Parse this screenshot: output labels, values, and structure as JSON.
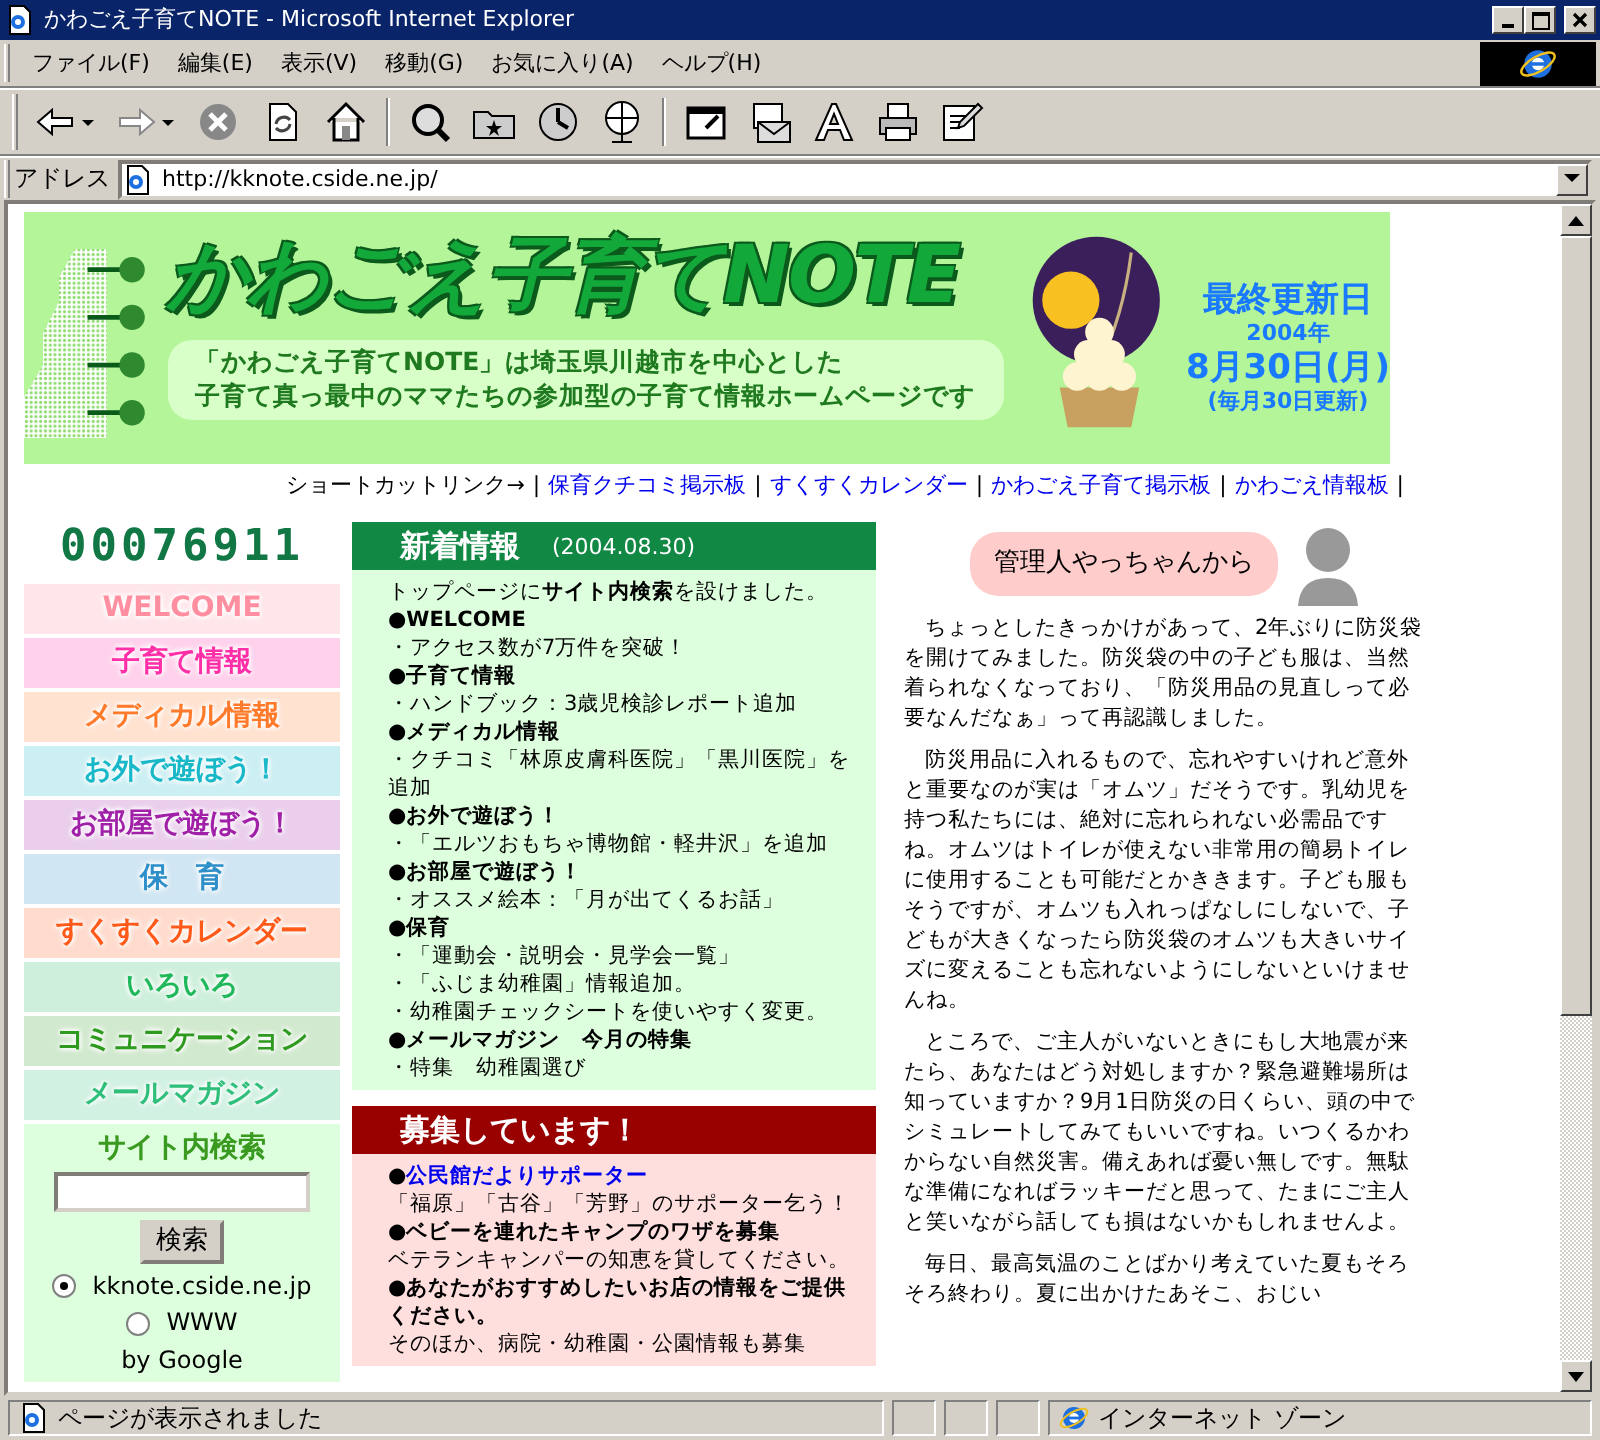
{
  "window": {
    "title": "かわごえ子育てNOTE - Microsoft Internet Explorer"
  },
  "menu": [
    "ファイル(F)",
    "編集(E)",
    "表示(V)",
    "移動(G)",
    "お気に入り(A)",
    "ヘルプ(H)"
  ],
  "address_bar": {
    "label": "アドレス",
    "value": "http://kknote.cside.ne.jp/"
  },
  "banner": {
    "title": "かわごえ子育てNOTE",
    "tagline": [
      "「かわごえ子育てNOTE」は埼玉県川越市を中心とした",
      "子育て真っ最中のママたちの参加型の子育て情報ホームページです"
    ],
    "updated_label": "最終更新日",
    "updated_year": "2004年",
    "updated_date": "8月30日(月)",
    "update_note": "(毎月30日更新)"
  },
  "shortcuts": {
    "label": "ショートカットリンク→",
    "separator": "|",
    "links": [
      "保育クチコミ掲示板",
      "すくすくカレンダー",
      "かわごえ子育て掲示板",
      "かわごえ情報板"
    ]
  },
  "counter": "00076911",
  "sidebar": {
    "items": [
      {
        "label": "WELCOME",
        "color": "#ff8fa0"
      },
      {
        "label": "子育て情報",
        "color": "#ff2fa8"
      },
      {
        "label": "メディカル情報",
        "color": "#ff7a2a"
      },
      {
        "label": "お外で遊ぼう！",
        "color": "#19b8c8"
      },
      {
        "label": "お部屋で遊ぼう！",
        "color": "#a020a8"
      },
      {
        "label": "保　育",
        "color": "#2f8fc8"
      },
      {
        "label": "すくすくカレンダー",
        "color": "#ff5a1a"
      },
      {
        "label": "いろいろ",
        "color": "#1fb85a"
      },
      {
        "label": "コミュニケーション",
        "color": "#2f9a20"
      },
      {
        "label": "メールマガジン",
        "color": "#2fbf7a"
      }
    ]
  },
  "site_search": {
    "title": "サイト内検索",
    "button": "検索",
    "options": [
      {
        "label": "kknote.cside.ne.jp",
        "selected": true
      },
      {
        "label": "WWW",
        "selected": false
      }
    ],
    "credit": "by Google"
  },
  "news": {
    "title": "新着情報",
    "date": "(2004.08.30)",
    "items": [
      {
        "text": "トップページに**サイト内検索**を設けました。"
      },
      {
        "text": "**●WELCOME**"
      },
      {
        "text": "・アクセス数が7万件を突破！"
      },
      {
        "text": "**●子育て情報**"
      },
      {
        "text": "・ハンドブック：3歳児検診レポート追加"
      },
      {
        "text": "**●メディカル情報**"
      },
      {
        "text": "・クチコミ「林原皮膚科医院」「黒川医院」を追加"
      },
      {
        "text": "**●お外で遊ぼう！**"
      },
      {
        "text": "・「エルツおもちゃ博物館・軽井沢」を追加"
      },
      {
        "text": "**●お部屋で遊ぼう！**"
      },
      {
        "text": "・オススメ絵本：「月が出てくるお話」"
      },
      {
        "text": "**●保育**"
      },
      {
        "text": "・「運動会・説明会・見学会一覧」"
      },
      {
        "text": "・「ふじま幼稚園」情報追加。"
      },
      {
        "text": "・幼稚園チェックシートを使いやすく変更。"
      },
      {
        "text": "**●メールマガジン　今月の特集**"
      },
      {
        "text": "・特集　幼稚園選び"
      }
    ]
  },
  "recruit": {
    "title": "募集しています！",
    "items": [
      {
        "marker": "**●**",
        "link": "**公民館だよりサポーター**"
      },
      {
        "text": "「福原」「古谷」「芳野」のサポーター乞う！"
      },
      {
        "text": "**●ベビーを連れたキャンプのワザを募集**"
      },
      {
        "text": "ベテランキャンパーの知恵を貸してください。"
      },
      {
        "text": "**●あなたがおすすめしたいお店の情報をご提供ください。**"
      },
      {
        "text": "そのほか、病院・幼稚園・公園情報も募集"
      }
    ]
  },
  "admin": {
    "bubble": "管理人やっちゃんから",
    "paragraphs": [
      "ちょっとしたきっかけがあって、2年ぶりに防災袋を開けてみました。防災袋の中の子ども服は、当然着られなくなっており、「防災用品の見直しって必要なんだなぁ」って再認識しました。",
      "防災用品に入れるもので、忘れやすいけれど意外と重要なのが実は「オムツ」だそうです。乳幼児を持つ私たちには、絶対に忘れられない必需品ですね。オムツはトイレが使えない非常用の簡易トイレに使用することも可能だとかききます。子ども服もそうですが、オムツも入れっぱなしにしないで、子どもが大きくなったら防災袋のオムツも大きいサイズに変えることも忘れないようにしないといけませんね。",
      "ところで、ご主人がいないときにもし大地震が来たら、あなたはどう対処しますか？緊急避難場所は知っていますか？9月1日防災の日くらい、頭の中でシミュレートしてみてもいいですね。いつくるかわからない自然災害。備えあれば憂い無しです。無駄な準備になればラッキーだと思って、たまにご主人と笑いながら話しても損はないかもしれませんよ。",
      "毎日、最高気温のことばかり考えていた夏もそろそろ終わり。夏に出かけたあそこ、おじい"
    ]
  },
  "status_bar": {
    "text": "ページが表示されました",
    "zone": "インターネット ゾーン"
  }
}
